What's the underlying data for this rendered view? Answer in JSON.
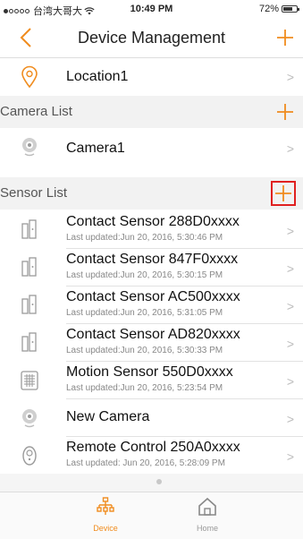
{
  "status_bar": {
    "carrier": "台湾大哥大",
    "time": "10:49 PM",
    "battery": "72%",
    "battery_level": 0.72
  },
  "nav": {
    "title": "Device Management",
    "back_icon": "chevron-left-icon",
    "add_icon": "plus-icon"
  },
  "location": {
    "label": "Location1"
  },
  "camera_section": {
    "label": "Camera List"
  },
  "camera": {
    "label": "Camera1"
  },
  "sensor_section": {
    "label": "Sensor List"
  },
  "sensors": [
    {
      "name": "Contact Sensor 288D0xxxx",
      "updated": "Last updated:Jun 20, 2016, 5:30:46 PM",
      "icon": "contact-sensor-icon"
    },
    {
      "name": "Contact Sensor 847F0xxxx",
      "updated": "Last updated:Jun 20, 2016, 5:30:15 PM",
      "icon": "contact-sensor-icon"
    },
    {
      "name": "Contact Sensor AC500xxxx",
      "updated": "Last updated:Jun 20, 2016, 5:31:05 PM",
      "icon": "contact-sensor-icon"
    },
    {
      "name": "Contact Sensor AD820xxxx",
      "updated": "Last updated:Jun 20, 2016, 5:30:33 PM",
      "icon": "contact-sensor-icon"
    },
    {
      "name": "Motion Sensor 550D0xxxx",
      "updated": "Last updated:Jun 20, 2016, 5:23:54 PM",
      "icon": "motion-sensor-icon"
    },
    {
      "name": "New Camera",
      "updated": "",
      "icon": "camera-icon"
    },
    {
      "name": "Remote Control 250A0xxxx",
      "updated": "Last updated: Jun 20, 2016, 5:28:09 PM",
      "icon": "remote-control-icon"
    }
  ],
  "tabs": [
    {
      "label": "Device",
      "icon": "device-tree-icon",
      "active": true
    },
    {
      "label": "Home",
      "icon": "home-icon",
      "active": false
    }
  ],
  "colors": {
    "accent": "#f08c1e",
    "highlight_box": "#e02020",
    "section_bg": "#f2f2f2"
  }
}
